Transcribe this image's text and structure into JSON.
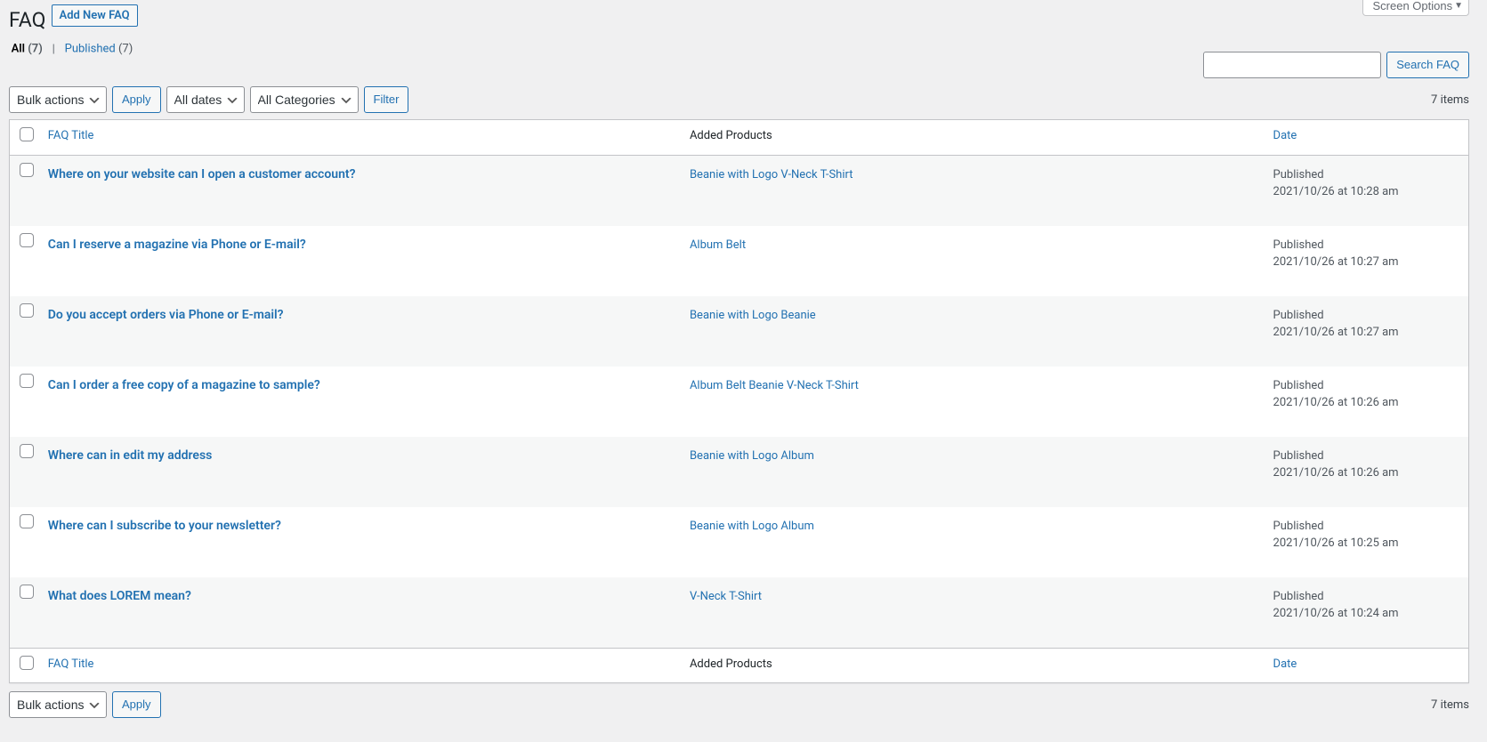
{
  "header": {
    "title": "FAQ",
    "add_new_label": "Add New FAQ",
    "screen_options_label": "Screen Options"
  },
  "views": {
    "all_label": "All",
    "all_count": "(7)",
    "published_label": "Published",
    "published_count": "(7)"
  },
  "search": {
    "button_label": "Search FAQ"
  },
  "bulk": {
    "action_label": "Bulk actions",
    "apply_label": "Apply",
    "dates_label": "All dates",
    "categories_label": "All Categories",
    "filter_label": "Filter"
  },
  "count_label": "7 items",
  "columns": {
    "title": "FAQ Title",
    "products": "Added Products",
    "date": "Date"
  },
  "rows": [
    {
      "title": "Where on your website can I open a customer account?",
      "products": "Beanie with Logo V-Neck T-Shirt",
      "status": "Published",
      "date": "2021/10/26 at 10:28 am"
    },
    {
      "title": "Can I reserve a magazine via Phone or E-mail?",
      "products": "Album Belt",
      "status": "Published",
      "date": "2021/10/26 at 10:27 am"
    },
    {
      "title": "Do you accept orders via Phone or E-mail?",
      "products": "Beanie with Logo Beanie",
      "status": "Published",
      "date": "2021/10/26 at 10:27 am"
    },
    {
      "title": "Can I order a free copy of a magazine to sample?",
      "products": "Album Belt Beanie V-Neck T-Shirt",
      "status": "Published",
      "date": "2021/10/26 at 10:26 am"
    },
    {
      "title": "Where can in edit my address",
      "products": "Beanie with Logo Album",
      "status": "Published",
      "date": "2021/10/26 at 10:26 am"
    },
    {
      "title": "Where can I subscribe to your newsletter?",
      "products": "Beanie with Logo Album",
      "status": "Published",
      "date": "2021/10/26 at 10:25 am"
    },
    {
      "title": "What does LOREM mean?",
      "products": "V-Neck T-Shirt",
      "status": "Published",
      "date": "2021/10/26 at 10:24 am"
    }
  ]
}
